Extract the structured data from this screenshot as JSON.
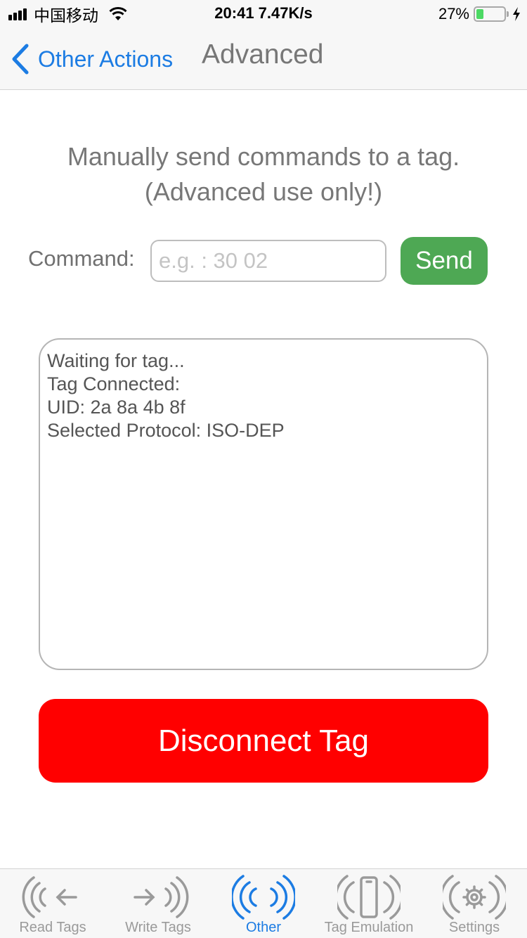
{
  "status_bar": {
    "carrier": "中国移动",
    "time_speed": "20:41 7.47K/s",
    "battery_percent": "27%",
    "battery_level": 0.27,
    "battery_color": "#4cd964"
  },
  "nav": {
    "back_label": "Other Actions",
    "title": "Advanced",
    "accent_color": "#1c7ce3"
  },
  "intro": {
    "line1": "Manually send commands to a tag.",
    "line2": "(Advanced use only!)"
  },
  "command": {
    "label": "Command:",
    "value": "",
    "placeholder": "e.g. : 30 02",
    "send_label": "Send",
    "send_color": "#4ea854"
  },
  "log": {
    "lines": [
      "Waiting for tag...",
      "Tag Connected:",
      "UID: 2a 8a 4b 8f",
      "Selected Protocol: ISO-DEP"
    ]
  },
  "disconnect": {
    "label": "Disconnect Tag",
    "color": "#ff0000"
  },
  "tabs": [
    {
      "label": "Read Tags",
      "icon": "nfc-read-icon",
      "active": false
    },
    {
      "label": "Write Tags",
      "icon": "nfc-write-icon",
      "active": false
    },
    {
      "label": "Other",
      "icon": "nfc-waves-icon",
      "active": true
    },
    {
      "label": "Tag Emulation",
      "icon": "phone-emulation-icon",
      "active": false
    },
    {
      "label": "Settings",
      "icon": "gear-icon",
      "active": false
    }
  ]
}
